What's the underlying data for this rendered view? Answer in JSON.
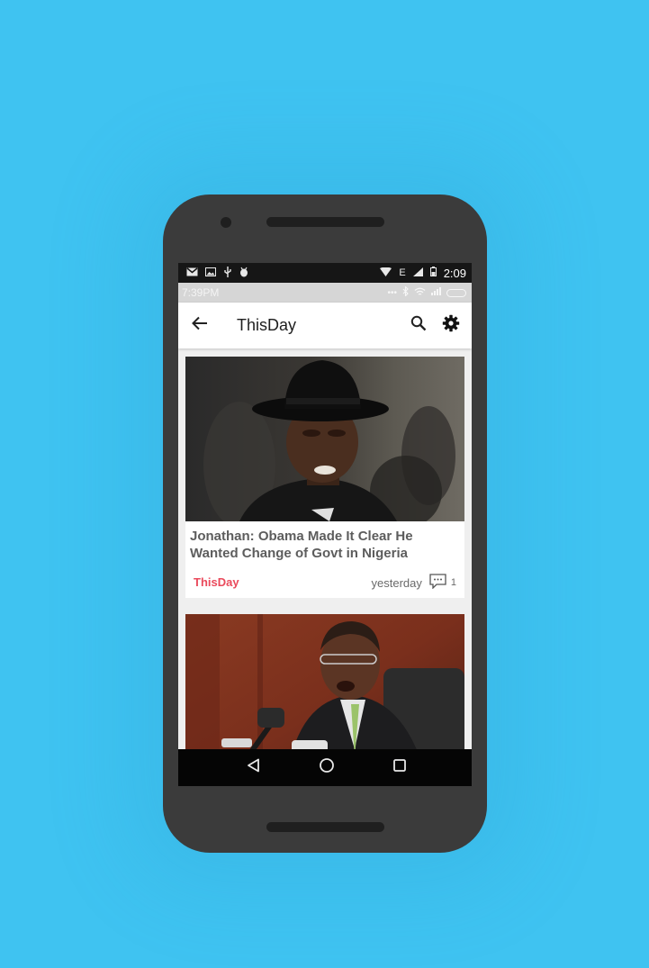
{
  "status_bar": {
    "time": "2:09",
    "network": "E",
    "left_icons": [
      "gmail-icon",
      "gallery-icon",
      "usb-icon",
      "android-debug-icon"
    ]
  },
  "status_bar_secondary": {
    "time": "7:39PM"
  },
  "app_bar": {
    "title": "ThisDay",
    "back_icon": "arrow-back-icon",
    "actions": [
      "search-icon",
      "settings-icon"
    ]
  },
  "articles": [
    {
      "headline": "Jonathan: Obama Made It Clear He Wanted Change of Govt in Nigeria",
      "source": "ThisDay",
      "time": "yesterday",
      "comments": "1"
    },
    {
      "headline": "",
      "source": "",
      "time": "",
      "comments": ""
    }
  ],
  "nav_bar": {
    "buttons": [
      "back-triangle-icon",
      "home-circle-icon",
      "recents-square-icon"
    ]
  },
  "colors": {
    "background": "#3fc3f1",
    "phone_body": "#3b3b3b",
    "source_accent": "#ea4a5c",
    "headline_text": "#5d5d5d"
  }
}
